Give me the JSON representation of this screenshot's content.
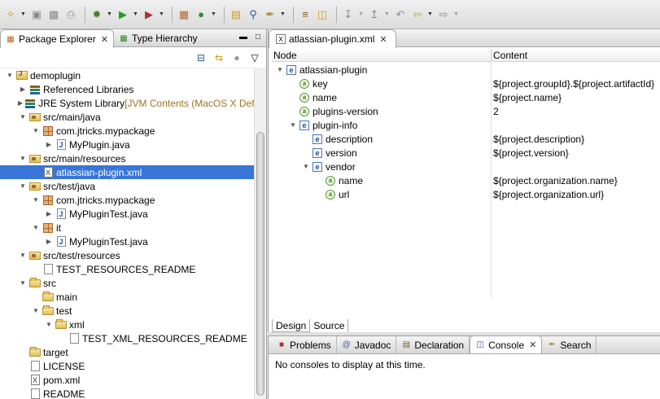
{
  "toolbar": {
    "icons": [
      "new-wizard-icon",
      "save-icon",
      "save-all-icon",
      "print-icon",
      "debug-icon",
      "run-icon",
      "external-tools-icon",
      "new-package-icon",
      "new-class-icon",
      "open-type-icon",
      "search-icon",
      "annotation-icon",
      "next-annotation-icon",
      "prev-annotation-icon",
      "back-icon",
      "forward-icon"
    ]
  },
  "left": {
    "tabs": [
      {
        "label": "Package Explorer",
        "active": true
      },
      {
        "label": "Type Hierarchy",
        "active": false
      }
    ],
    "tree": [
      {
        "label": "demoplugin",
        "indent": 0,
        "twisty": "open",
        "icon": "project"
      },
      {
        "label": "Referenced Libraries",
        "indent": 1,
        "twisty": "closed",
        "icon": "lib"
      },
      {
        "label": "JRE System Library",
        "decor": " [JVM Contents (MacOS X Defau",
        "indent": 1,
        "twisty": "closed",
        "icon": "lib"
      },
      {
        "label": "src/main/java",
        "indent": 1,
        "twisty": "open",
        "icon": "srcfolder"
      },
      {
        "label": "com.jtricks.mypackage",
        "indent": 2,
        "twisty": "open",
        "icon": "package"
      },
      {
        "label": "MyPlugin.java",
        "indent": 3,
        "twisty": "closed",
        "icon": "java"
      },
      {
        "label": "src/main/resources",
        "indent": 1,
        "twisty": "open",
        "icon": "srcfolder"
      },
      {
        "label": "atlassian-plugin.xml",
        "indent": 2,
        "twisty": "none",
        "icon": "xml",
        "selected": true
      },
      {
        "label": "src/test/java",
        "indent": 1,
        "twisty": "open",
        "icon": "srcfolder"
      },
      {
        "label": "com.jtricks.mypackage",
        "indent": 2,
        "twisty": "open",
        "icon": "package"
      },
      {
        "label": "MyPluginTest.java",
        "indent": 3,
        "twisty": "closed",
        "icon": "java"
      },
      {
        "label": "it",
        "indent": 2,
        "twisty": "open",
        "icon": "package"
      },
      {
        "label": "MyPluginTest.java",
        "indent": 3,
        "twisty": "closed",
        "icon": "java"
      },
      {
        "label": "src/test/resources",
        "indent": 1,
        "twisty": "open",
        "icon": "srcfolder"
      },
      {
        "label": "TEST_RESOURCES_README",
        "indent": 2,
        "twisty": "none",
        "icon": "file"
      },
      {
        "label": "src",
        "indent": 1,
        "twisty": "open",
        "icon": "folder"
      },
      {
        "label": "main",
        "indent": 2,
        "twisty": "none",
        "icon": "folder"
      },
      {
        "label": "test",
        "indent": 2,
        "twisty": "open",
        "icon": "folder"
      },
      {
        "label": "xml",
        "indent": 3,
        "twisty": "open",
        "icon": "folder"
      },
      {
        "label": "TEST_XML_RESOURCES_README",
        "indent": 4,
        "twisty": "none",
        "icon": "file"
      },
      {
        "label": "target",
        "indent": 1,
        "twisty": "none",
        "icon": "folder"
      },
      {
        "label": "LICENSE",
        "indent": 1,
        "twisty": "none",
        "icon": "file"
      },
      {
        "label": "pom.xml",
        "indent": 1,
        "twisty": "none",
        "icon": "xml"
      },
      {
        "label": "README",
        "indent": 1,
        "twisty": "none",
        "icon": "file"
      }
    ]
  },
  "editor": {
    "tab_label": "atlassian-plugin.xml",
    "columns": [
      "Node",
      "Content"
    ],
    "rows": [
      {
        "node": "atlassian-plugin",
        "content": "",
        "indent": 0,
        "kind": "e",
        "twisty": "open"
      },
      {
        "node": "key",
        "content": "${project.groupId}.${project.artifactId}",
        "indent": 1,
        "kind": "a",
        "twisty": "none"
      },
      {
        "node": "name",
        "content": "${project.name}",
        "indent": 1,
        "kind": "a",
        "twisty": "none"
      },
      {
        "node": "plugins-version",
        "content": "2",
        "indent": 1,
        "kind": "a",
        "twisty": "none"
      },
      {
        "node": "plugin-info",
        "content": "",
        "indent": 1,
        "kind": "e",
        "twisty": "open"
      },
      {
        "node": "description",
        "content": "${project.description}",
        "indent": 2,
        "kind": "e",
        "twisty": "none"
      },
      {
        "node": "version",
        "content": "${project.version}",
        "indent": 2,
        "kind": "e",
        "twisty": "none"
      },
      {
        "node": "vendor",
        "content": "",
        "indent": 2,
        "kind": "e",
        "twisty": "open"
      },
      {
        "node": "name",
        "content": "${project.organization.name}",
        "indent": 3,
        "kind": "a",
        "twisty": "none"
      },
      {
        "node": "url",
        "content": "${project.organization.url}",
        "indent": 3,
        "kind": "a",
        "twisty": "none"
      }
    ],
    "subtabs": [
      {
        "label": "Design",
        "active": true
      },
      {
        "label": "Source",
        "active": false
      }
    ]
  },
  "bottom": {
    "tabs": [
      {
        "label": "Problems",
        "icon": "problems-icon",
        "active": false
      },
      {
        "label": "Javadoc",
        "icon": "javadoc-icon",
        "active": false
      },
      {
        "label": "Declaration",
        "icon": "declaration-icon",
        "active": false
      },
      {
        "label": "Console",
        "icon": "console-icon",
        "active": true
      },
      {
        "label": "Search",
        "icon": "search-icon",
        "active": false
      }
    ],
    "message": "No consoles to display at this time."
  },
  "colors": {
    "selection": "#3875d7",
    "toolbar_bg": "#e4e4e4"
  }
}
